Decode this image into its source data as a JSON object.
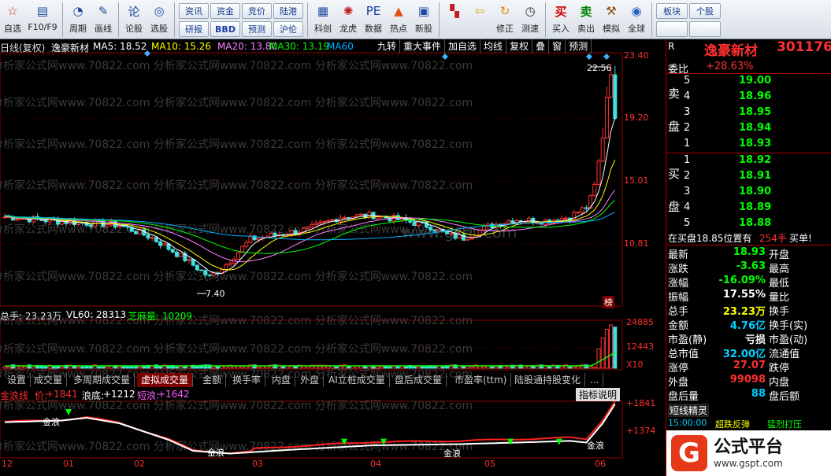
{
  "toolbar": {
    "items": [
      {
        "label": "自选",
        "icon": "star-icon"
      },
      {
        "label": "F10/F9",
        "icon": "f10-icon"
      },
      {
        "label": "周期",
        "icon": "cycle-icon"
      },
      {
        "label": "画线",
        "icon": "pen-icon"
      },
      {
        "label": "论股",
        "icon": "discuss-icon"
      },
      {
        "label": "选股",
        "icon": "select-icon"
      }
    ],
    "grid_buttons": [
      "资讯",
      "资金",
      "竞价",
      "陆港",
      "研报",
      "BBD",
      "预测",
      "沪伦"
    ],
    "items2": [
      {
        "label": "科创",
        "icon": "chart-icon"
      },
      {
        "label": "龙虎",
        "icon": "dragon-icon"
      },
      {
        "label": "数据",
        "icon": "pe-icon"
      },
      {
        "label": "热点",
        "icon": "hot-icon"
      },
      {
        "label": "新股",
        "icon": "ipo-icon"
      }
    ],
    "items3": [
      {
        "label": "",
        "icon": "blocks-icon"
      },
      {
        "label": "",
        "icon": "back-arrow-icon"
      },
      {
        "label": "修正",
        "icon": "correct-icon"
      },
      {
        "label": "测速",
        "icon": "clock-icon"
      }
    ],
    "items4": [
      {
        "label": "买入",
        "glyph": "买"
      },
      {
        "label": "卖出",
        "glyph": "卖"
      },
      {
        "label": "模拟",
        "icon": "hammer-icon"
      },
      {
        "label": "全球",
        "icon": "globe-icon"
      }
    ],
    "grid_buttons2": [
      "板块",
      "个股",
      "",
      ""
    ]
  },
  "chart_header": {
    "period": "日线(复权)",
    "stock_name": "逸豪新材",
    "ma5": "MA5: 18.52",
    "ma10": "MA10: 15.26",
    "ma20": "MA20: 13.80",
    "ma30": "MA30: 13.19",
    "ma60": "MA60",
    "buttons": [
      "九转",
      "重大事件",
      "加自选",
      "均线",
      "复权",
      "叠",
      "窗",
      "预测"
    ]
  },
  "price_axis": [
    "23.40",
    "19.20",
    "15.01",
    "10.81"
  ],
  "high_marker": "22.56",
  "low_marker": "7.40",
  "rank_badge": "榜",
  "volume_header": {
    "total": "总手: 23.23万",
    "vl60": "VL60: 28313",
    "sesame": "芝麻量: 10209"
  },
  "volume_axis": [
    "24885",
    "12443",
    "X10"
  ],
  "indicator_tabs": [
    "设置",
    "成交量",
    "多周期成交量",
    "虚拟成交量",
    "金额",
    "换手率",
    "内盘",
    "外盘",
    "AI立桩成交量",
    "盘后成交量",
    "市盈率(ttm)",
    "陆股通持股变化",
    "..."
  ],
  "active_tab": "虚拟成交量",
  "indicator_header": {
    "name": "金浪线",
    "price_label": "价:",
    "price_val": "+1841",
    "wave_label": "浪底:",
    "wave_val": "+1212",
    "short_label": "短浪:",
    "short_val": "+1642"
  },
  "indicator_help": "指标说明",
  "indicator_axis": [
    "+1841",
    "+1374"
  ],
  "gold_wave_label": "金浪",
  "date_axis": [
    "12",
    "01",
    "02",
    "03",
    "04",
    "05",
    "06"
  ],
  "watermark": "分析家公式网www.70822.com",
  "watermark_mid": "www.gspt.com",
  "stock_header": {
    "name": "逸豪新材",
    "code": "301176",
    "r_label": "R"
  },
  "weibi": {
    "label": "委比",
    "value": "+28.63%"
  },
  "sell_label": "卖盘",
  "buy_label": "买盘",
  "sell_orders": [
    {
      "level": "5",
      "price": "19.00"
    },
    {
      "level": "4",
      "price": "18.96"
    },
    {
      "level": "3",
      "price": "18.95"
    },
    {
      "level": "2",
      "price": "18.94"
    },
    {
      "level": "1",
      "price": "18.93"
    }
  ],
  "buy_orders": [
    {
      "level": "1",
      "price": "18.92"
    },
    {
      "level": "2",
      "price": "18.91"
    },
    {
      "level": "3",
      "price": "18.90"
    },
    {
      "level": "4",
      "price": "18.89"
    },
    {
      "level": "5",
      "price": "18.88"
    }
  ],
  "notice": {
    "text": "在买盘18.85位置有",
    "qty": "254手",
    "action": "买单!"
  },
  "quote": [
    {
      "l": "最新",
      "v": "18.93",
      "l2": "开盘",
      "c": "#00ff00"
    },
    {
      "l": "涨跌",
      "v": "-3.63",
      "l2": "最高",
      "c": "#00ff00"
    },
    {
      "l": "涨幅",
      "v": "-16.09%",
      "l2": "最低",
      "c": "#00ff00"
    },
    {
      "l": "振幅",
      "v": "17.55%",
      "l2": "量比",
      "c": "#ffffff"
    },
    {
      "l": "总手",
      "v": "23.23万",
      "l2": "换手",
      "c": "#ffff00"
    },
    {
      "l": "金额",
      "v": "4.76亿",
      "l2": "换手(实)",
      "c": "#00d0ff"
    },
    {
      "l": "市盈(静)",
      "v": "亏损",
      "l2": "市盈(动)",
      "c": "#ffffff"
    },
    {
      "l": "总市值",
      "v": "32.00亿",
      "l2": "流通值",
      "c": "#00d0ff"
    },
    {
      "l": "涨停",
      "v": "27.07",
      "l2": "跌停",
      "c": "#ff3030"
    },
    {
      "l": "外盘",
      "v": "99098",
      "l2": "内盘",
      "c": "#ff3030"
    },
    {
      "l": "盘后量",
      "v": "88",
      "l2": "盘后额",
      "c": "#00d0ff"
    }
  ],
  "short_elf": {
    "label": "短线精灵",
    "time": "15:00:00",
    "event": "超跌反弹",
    "title": "猛烈打压"
  },
  "logo": {
    "text": "公式平台",
    "url": "www.gspt.com"
  }
}
